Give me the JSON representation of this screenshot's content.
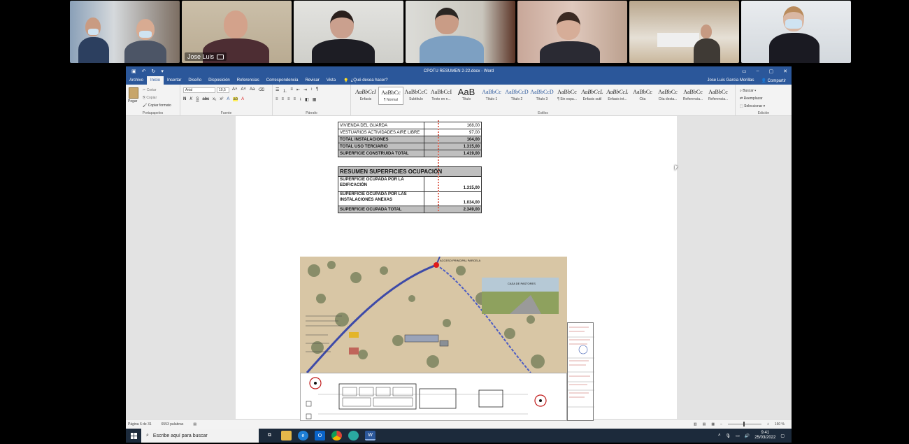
{
  "participants": [
    {
      "id": "p1",
      "label": ""
    },
    {
      "id": "p2",
      "label": "Jose Luis"
    },
    {
      "id": "p3",
      "label": ""
    },
    {
      "id": "p4",
      "label": ""
    },
    {
      "id": "p5",
      "label": ""
    },
    {
      "id": "p6",
      "label": ""
    },
    {
      "id": "p7",
      "label": ""
    }
  ],
  "word": {
    "title": "CPOTU RESUMEN 2-22.docx - Word",
    "user": "Jose Luis Garcia Morillas",
    "share": "Compartir",
    "tabs": [
      "Archivo",
      "Inicio",
      "Insertar",
      "Diseño",
      "Disposición",
      "Referencias",
      "Correspondencia",
      "Revisar",
      "Vista"
    ],
    "tell_me": "¿Qué desea hacer?",
    "clipboard": {
      "paste": "Pegar",
      "cut": "Cortar",
      "copy": "Copiar",
      "format_painter": "Copiar formato",
      "group": "Portapapeles"
    },
    "font": {
      "name": "Arial",
      "size": "10,5",
      "group": "Fuente"
    },
    "paragraph_group": "Párrafo",
    "styles_group": "Estilos",
    "styles": [
      {
        "preview": "AaBbCcI",
        "label": "Énfasis"
      },
      {
        "preview": "AaBbCc",
        "label": "¶ Normal"
      },
      {
        "preview": "AaBbCcC",
        "label": "Subtítulo"
      },
      {
        "preview": "AaBbCcI",
        "label": "Texto en n..."
      },
      {
        "preview": "AaB",
        "label": "Título"
      },
      {
        "preview": "AaBbCc",
        "label": "Título 1"
      },
      {
        "preview": "AaBbCcD",
        "label": "Título 2"
      },
      {
        "preview": "AaBbCcD",
        "label": "Título 3"
      },
      {
        "preview": "AaBbCc",
        "label": "¶ Sin espa..."
      },
      {
        "preview": "AaBbCcL",
        "label": "Énfasis sutil"
      },
      {
        "preview": "AaBbCcL",
        "label": "Énfasis int..."
      },
      {
        "preview": "AaBbCc",
        "label": "Cita"
      },
      {
        "preview": "AaBbCc",
        "label": "Cita desta..."
      },
      {
        "preview": "AaBbCc",
        "label": "Referencia..."
      },
      {
        "preview": "AaBbCc",
        "label": "Referencia..."
      }
    ],
    "editing": {
      "find": "Buscar",
      "replace": "Reemplazar",
      "select": "Seleccionar",
      "group": "Edición"
    },
    "status": {
      "page": "Página 6 de 31",
      "words": "6553 palabras",
      "zoom": "160 %"
    }
  },
  "table1": [
    {
      "label": "VIVIENDA DEL GUARDA",
      "value": "168,00",
      "shade": false
    },
    {
      "label": "VESTUARIOS ACTIVIDADES AIRE LIBRE",
      "value": "97,00",
      "shade": false
    },
    {
      "label": "TOTAL INSTALACIONES",
      "value": "104,00",
      "shade": true
    },
    {
      "label": "TOTAL USO TERCIARIO",
      "value": "1.315,00",
      "shade": true
    },
    {
      "label": "SUPERFICIE CONSTRUIDA TOTAL",
      "value": "1.419,00",
      "shade": true
    }
  ],
  "table2": {
    "title": "RESUMEN SUPERFICIES OCUPACIÓN",
    "rows": [
      {
        "label": "SUPERFICIE OCUPADA POR LA EDIFICACIÓN",
        "value": "1.315,00"
      },
      {
        "label": "SUPERFICIE OCUPADA POR LAS INSTALACIONES ANEXAS",
        "value": "1.034,00"
      }
    ],
    "total": {
      "label": "SUPERFICIE OCUPADA TOTAL",
      "value": "2.349,00"
    }
  },
  "map": {
    "inset_label": "CASA DE PASTORES",
    "access_label": "ACCESO PRINCIPAL PARCELA"
  },
  "taskbar": {
    "search_placeholder": "Escribe aquí para buscar",
    "time": "9:41",
    "date": "25/03/2022"
  },
  "colors": {
    "word_blue": "#2b579a",
    "taskbar": "#1c2a3b",
    "table_shade": "#bfbfbf"
  }
}
